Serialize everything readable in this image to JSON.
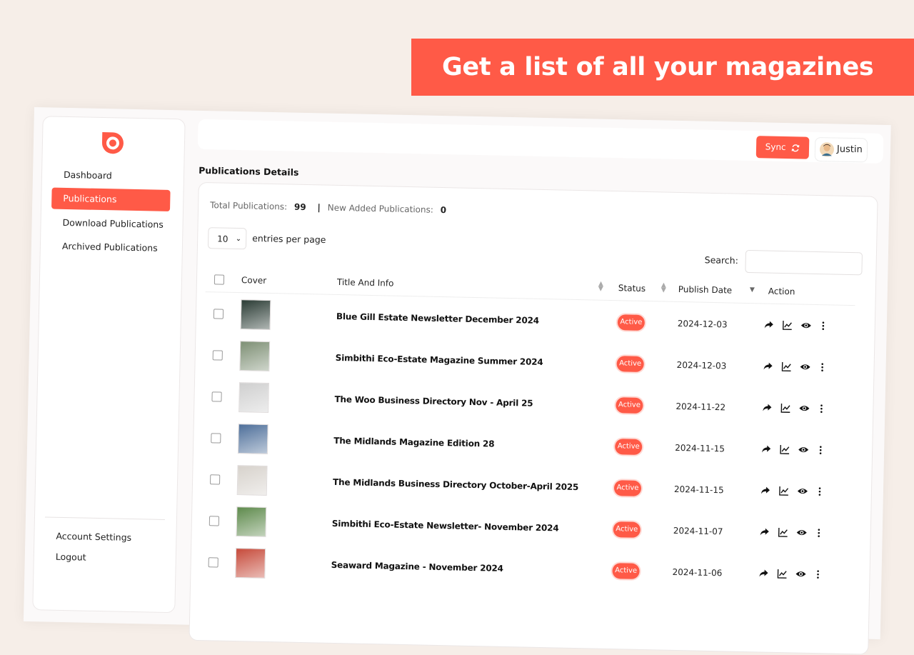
{
  "banner": {
    "headline": "Get a list of all your magazines"
  },
  "sidebar": {
    "items": [
      {
        "label": "Dashboard",
        "active": false
      },
      {
        "label": "Publications",
        "active": true
      },
      {
        "label": "Download Publications",
        "active": false
      },
      {
        "label": "Archived Publications",
        "active": false
      }
    ],
    "footer": [
      {
        "label": "Account Settings"
      },
      {
        "label": "Logout"
      }
    ]
  },
  "topbar": {
    "sync_label": "Sync",
    "user_name": "Justin"
  },
  "main": {
    "section_title": "Publications Details",
    "stats": {
      "total_label": "Total Publications:",
      "total_value": "99",
      "separator": "|",
      "new_label": "New Added Publications:",
      "new_value": "0"
    },
    "entries": {
      "selected": "10",
      "suffix": "entries per page"
    },
    "search": {
      "label": "Search:",
      "value": ""
    },
    "columns": {
      "cover": "Cover",
      "title": "Title And Info",
      "status": "Status",
      "publish_date": "Publish Date",
      "action": "Action"
    },
    "rows": [
      {
        "title": "Blue Gill Estate Newsletter December 2024",
        "status": "Active",
        "date": "2024-12-03",
        "cover_color": "#2a3b34"
      },
      {
        "title": "Simbithi Eco-Estate Magazine Summer 2024",
        "status": "Active",
        "date": "2024-12-03",
        "cover_color": "#7d8f74"
      },
      {
        "title": "The Woo Business Directory Nov - April 25",
        "status": "Active",
        "date": "2024-11-22",
        "cover_color": "#cfcfcf"
      },
      {
        "title": "The Midlands Magazine Edition 28",
        "status": "Active",
        "date": "2024-11-15",
        "cover_color": "#4e6f9a"
      },
      {
        "title": "The Midlands Business Directory October-April 2025",
        "status": "Active",
        "date": "2024-11-15",
        "cover_color": "#d7d2cc"
      },
      {
        "title": "Simbithi Eco-Estate Newsletter- November 2024",
        "status": "Active",
        "date": "2024-11-07",
        "cover_color": "#5e8a4c"
      },
      {
        "title": "Seaward Magazine - November 2024",
        "status": "Active",
        "date": "2024-11-06",
        "cover_color": "#c64a3a"
      }
    ]
  },
  "colors": {
    "accent": "#ff5a47",
    "background": "#f6eee8"
  }
}
